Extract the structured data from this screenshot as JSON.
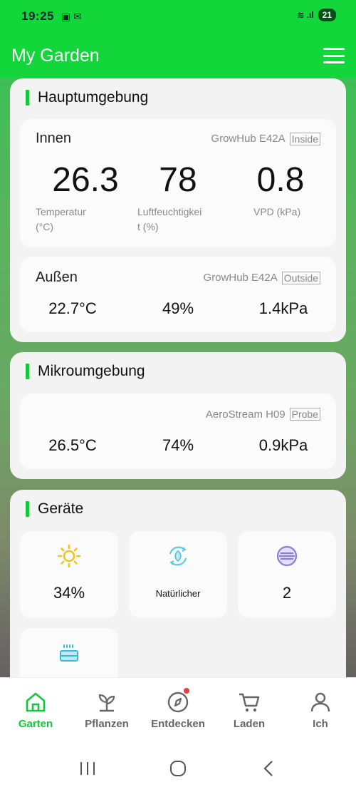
{
  "status": {
    "time": "19:25",
    "left_icons": "▣ ✉",
    "signal": "≋ .ıl",
    "battery": "21"
  },
  "header": {
    "title": "My Garden"
  },
  "main_env": {
    "title": "Hauptumgebung",
    "indoor": {
      "label": "Innen",
      "device": "GrowHub E42A",
      "tag": "Inside",
      "temp": "26.3",
      "temp_label_1": "Temperatur",
      "temp_label_2": "(°C)",
      "humidity": "78",
      "humidity_label_1": "Luftfeuchtigkei",
      "humidity_label_2": "t (%)",
      "vpd": "0.8",
      "vpd_label": "VPD (kPa)"
    },
    "outdoor": {
      "label": "Außen",
      "device": "GrowHub E42A",
      "tag": "Outside",
      "temp": "22.7°C",
      "humidity": "49%",
      "vpd": "1.4kPa"
    }
  },
  "micro_env": {
    "title": "Mikroumgebung",
    "device": "AeroStream H09",
    "tag": "Probe",
    "temp": "26.5°C",
    "humidity": "74%",
    "vpd": "0.9kPa"
  },
  "devices": {
    "title": "Geräte",
    "light_value": "34%",
    "fan_value": "Natürlicher",
    "filter_value": "2"
  },
  "tabs": [
    {
      "label": "Garten"
    },
    {
      "label": "Pflanzen"
    },
    {
      "label": "Entdecken"
    },
    {
      "label": "Laden"
    },
    {
      "label": "Ich"
    }
  ],
  "colors": {
    "accent": "#12d63a",
    "notification": "#ee3b3b"
  }
}
